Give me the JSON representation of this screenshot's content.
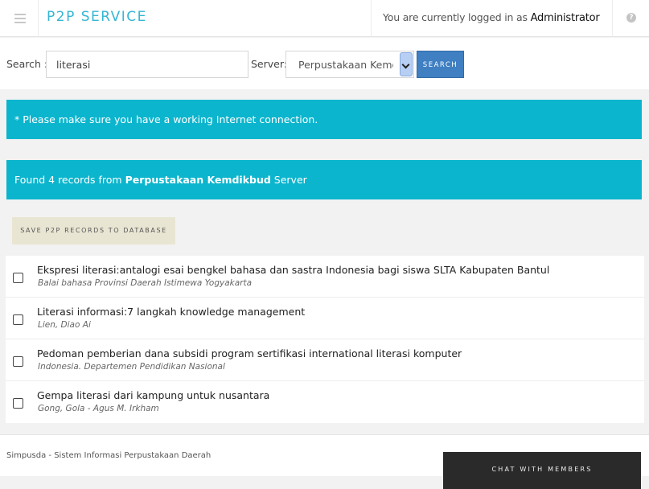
{
  "header": {
    "title": "P2P SERVICE",
    "login_prefix": "You are currently logged in as",
    "username": "Administrator",
    "help_glyph": "?"
  },
  "search": {
    "label": "Search :",
    "value": "literasi",
    "server_label": "Server:",
    "server_value": "Perpustakaan Kemdikbud",
    "button": "SEARCH"
  },
  "alerts": {
    "internet": "* Please make sure you have a working Internet connection.",
    "found_prefix": "Found 4 records from",
    "found_server": "Perpustakaan Kemdikbud",
    "found_suffix": "Server"
  },
  "save_button": "SAVE P2P RECORDS TO DATABASE",
  "records": [
    {
      "title": "Ekspresi literasi:antalogi esai bengkel bahasa dan sastra Indonesia bagi siswa SLTA Kabupaten Bantul",
      "author": "Balai bahasa Provinsi Daerah Istimewa Yogyakarta"
    },
    {
      "title": "Literasi informasi:7 langkah knowledge management",
      "author": "Lien, Diao Ai"
    },
    {
      "title": "Pedoman pemberian dana subsidi program sertifikasi international literasi komputer",
      "author": "Indonesia. Departemen Pendidikan Nasional"
    },
    {
      "title": "Gempa literasi dari kampung untuk nusantara",
      "author": "Gong, Gola - Agus M. Irkham"
    }
  ],
  "footer": {
    "text": "Simpusda - Sistem Informasi Perpustakaan Daerah",
    "chat_button": "CHAT WITH MEMBERS"
  },
  "colors": {
    "accent": "#35b6d3",
    "alert_bg": "#0bb5cd",
    "search_button": "#3f7fc2",
    "save_button_bg": "#e9e5d3",
    "chat_bg": "#2a2a2a"
  },
  "icons": {
    "menu": "hamburger-menu-icon",
    "help": "question-circle-icon",
    "dropdown": "chevron-down-icon",
    "checkbox": "checkbox-icon"
  }
}
